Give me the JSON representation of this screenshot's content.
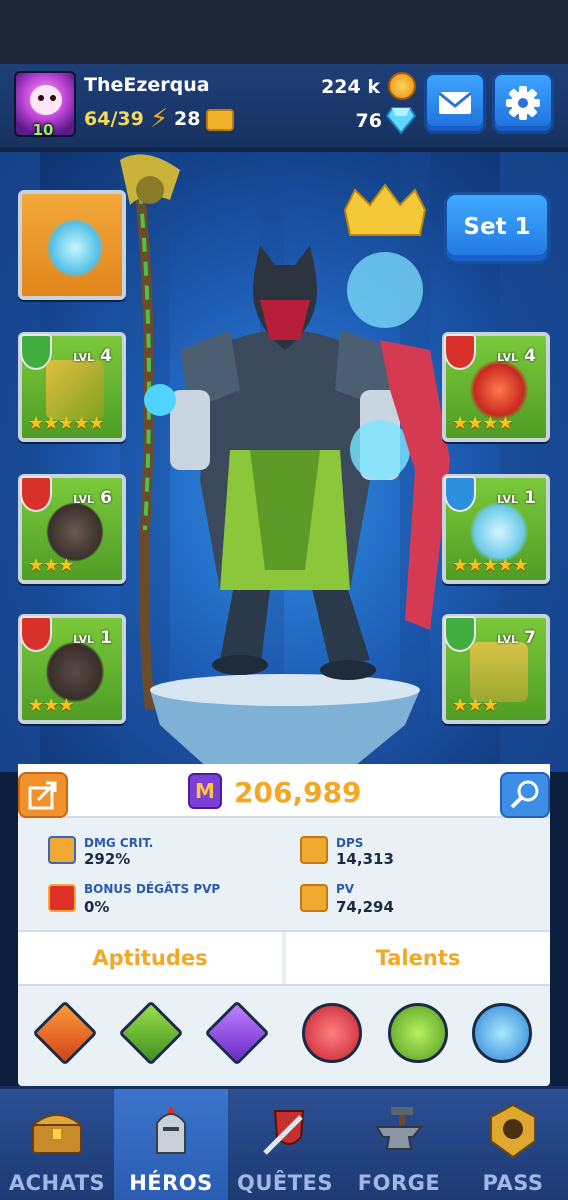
{
  "header": {
    "username": "TheEzerqua",
    "level": "10",
    "energy": "64/39",
    "keys": "28",
    "coins": "224 k",
    "gems": "76"
  },
  "set_button": {
    "label": "Set 1"
  },
  "equipment": {
    "left": [
      {
        "name": "accessory",
        "element": "",
        "level": "",
        "stars": ""
      },
      {
        "name": "weapon",
        "element": "nature",
        "level": "4",
        "stars": "★★★★★"
      },
      {
        "name": "head",
        "element": "fire",
        "level": "6",
        "stars": "★★★"
      },
      {
        "name": "armor",
        "element": "fire",
        "level": "1",
        "stars": "★★★"
      }
    ],
    "right": [
      {
        "name": "offhand",
        "element": "fire",
        "level": "4",
        "stars": "★★★★"
      },
      {
        "name": "gloves",
        "element": "water",
        "level": "1",
        "stars": "★★★★★"
      },
      {
        "name": "boots",
        "element": "nature",
        "level": "7",
        "stars": "★★★"
      }
    ],
    "lvl_label": "LVL"
  },
  "stats": {
    "power": "206,989",
    "power_letter": "M",
    "crit_label": "DMG CRIT.",
    "crit_value": "292%",
    "dps_label": "DPS",
    "dps_value": "14,313",
    "pvp_label": "BONUS DÉGÂTS PVP",
    "pvp_value": "0%",
    "pv_label": "PV",
    "pv_value": "74,294"
  },
  "tabs": {
    "aptitudes": "Aptitudes",
    "talents": "Talents"
  },
  "nav": [
    {
      "label": "ACHATS"
    },
    {
      "label": "HÉROS"
    },
    {
      "label": "QUÊTES"
    },
    {
      "label": "FORGE"
    },
    {
      "label": "PASS"
    }
  ],
  "colors": {
    "accent_orange": "#f5a623",
    "stat_blue": "#2a5aa8",
    "nav_bg": "#2b4f94"
  }
}
